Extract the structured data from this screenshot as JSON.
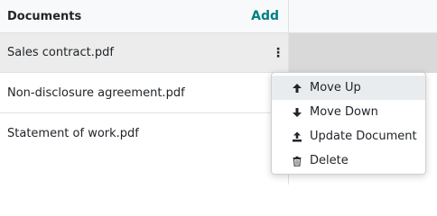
{
  "table": {
    "header_title": "Documents",
    "add_label": "Add",
    "rows": [
      {
        "name": "Sales contract.pdf"
      },
      {
        "name": "Non-disclosure agreement.pdf"
      },
      {
        "name": "Statement of work.pdf"
      }
    ]
  },
  "menu": {
    "items": [
      {
        "label": "Move Up",
        "icon": "arrow-up-icon"
      },
      {
        "label": "Move Down",
        "icon": "arrow-down-icon"
      },
      {
        "label": "Update Document",
        "icon": "upload-icon"
      },
      {
        "label": "Delete",
        "icon": "trash-icon"
      }
    ]
  },
  "colors": {
    "accent": "#017e84",
    "hover_row": "#ececec",
    "hover_cell": "#d9d9d9",
    "menu_active": "#e9ecef"
  }
}
